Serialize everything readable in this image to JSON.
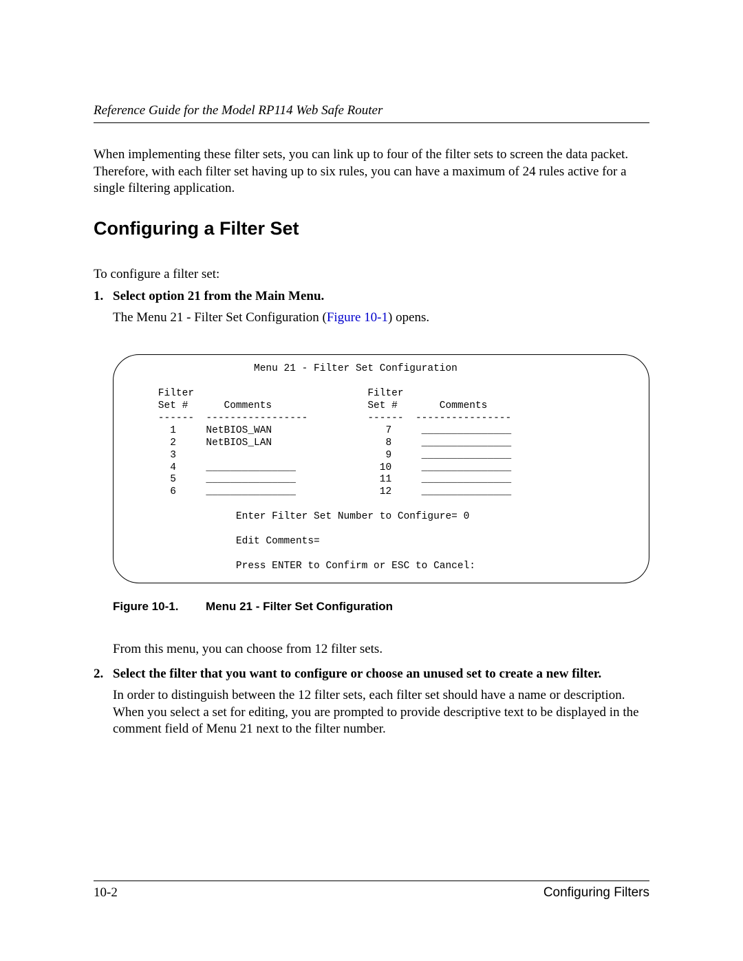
{
  "header_title": "Reference Guide for the Model RP114 Web Safe Router",
  "intro_paragraph": "When implementing these filter sets, you can link up to four of the filter sets to screen the data packet. Therefore, with each filter set having up to six rules, you can have a maximum of 24 rules active for a single filtering application.",
  "section_heading": "Configuring a Filter Set",
  "config_intro": "To configure a filter set:",
  "step1": {
    "title": "Select option 21 from the Main Menu.",
    "body_pre": "The Menu 21 - Filter Set Configuration (",
    "fig_ref": "Figure 10-1",
    "body_post": ") opens."
  },
  "terminal_text": "                    Menu 21 - Filter Set Configuration\n\n    Filter                             Filter\n    Set #      Comments                Set #       Comments\n    ------  -----------------          ------  ----------------\n      1     NetBIOS_WAN                   7     _______________\n      2     NetBIOS_LAN                   8     _______________\n      3                                   9     _______________\n      4     _______________              10     _______________\n      5     _______________              11     _______________\n      6     _______________              12     _______________\n\n                 Enter Filter Set Number to Configure= 0\n\n                 Edit Comments=\n\n                 Press ENTER to Confirm or ESC to Cancel:",
  "figure_caption_num": "Figure 10-1.",
  "figure_caption_title": "Menu 21 - Filter Set Configuration",
  "after_fig": "From this menu, you can choose from 12 filter sets.",
  "step2": {
    "title": "Select the filter that you want to configure or choose an unused set to create a new filter.",
    "body": "In order to distinguish between the 12 filter sets, each filter set should have a name or description. When you select a set for editing, you are prompted to provide descriptive text to be displayed in the comment field of Menu 21 next to the filter number."
  },
  "footer": {
    "page_number": "10-2",
    "section": "Configuring Filters"
  }
}
